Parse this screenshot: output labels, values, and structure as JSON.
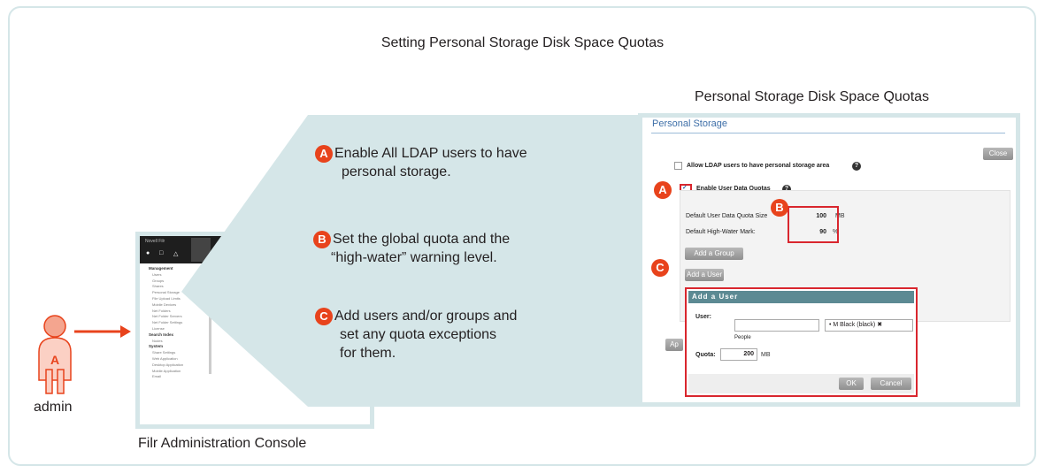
{
  "title": "Setting Personal Storage Disk Space Quotas",
  "panel_title": "Personal Storage Disk Space Quotas",
  "console_caption": "Filr Administration Console",
  "admin_label": "admin",
  "steps": [
    {
      "badge": "A",
      "line1": "Enable All LDAP users to have",
      "line2": "personal storage.",
      "line3": ""
    },
    {
      "badge": "B",
      "line1": "Set the global quota and the",
      "line2": "“high-water” warning level.",
      "line3": ""
    },
    {
      "badge": "C",
      "line1": "Add users and/or groups and",
      "line2": "set any quota exceptions",
      "line3": "for them."
    }
  ],
  "console": {
    "brand": "Novell Filr",
    "nav_items": [
      "Management",
      "Users",
      "Groups",
      "Shares",
      "Personal Storage",
      "File Upload Limits",
      "Mobile Devices",
      "Net Folders",
      "Net Folder Servers",
      "Net Folder Settings",
      "License",
      "Search Index",
      "Nodes",
      "System",
      "Share Settings",
      "Web Application",
      "Desktop Application",
      "Mobile Application",
      "Email"
    ]
  },
  "storage": {
    "heading": "Personal Storage",
    "close_label": "Close",
    "allow_ldap_label": "Allow LDAP users to have personal storage area",
    "enable_quotas_label": "Enable User Data Quotas",
    "default_quota_label": "Default User Data Quota Size",
    "default_quota_value": "100",
    "default_quota_unit": "MB",
    "highwater_label": "Default High-Water Mark:",
    "highwater_value": "90",
    "highwater_unit": "%",
    "add_group_label": "Add a Group",
    "add_user_label": "Add a User",
    "apply_label": "Ap"
  },
  "dialog": {
    "title": "Add a User",
    "user_label": "User:",
    "people_label": "People",
    "selected_user": "M Black (black)",
    "quota_label": "Quota:",
    "quota_value": "200",
    "quota_unit": "MB",
    "ok_label": "OK",
    "cancel_label": "Cancel"
  },
  "colors": {
    "badge": "#e8431c",
    "callout_fill": "#d5e6e8",
    "highlight_red": "#d9262e",
    "arrow": "#e8431c"
  }
}
